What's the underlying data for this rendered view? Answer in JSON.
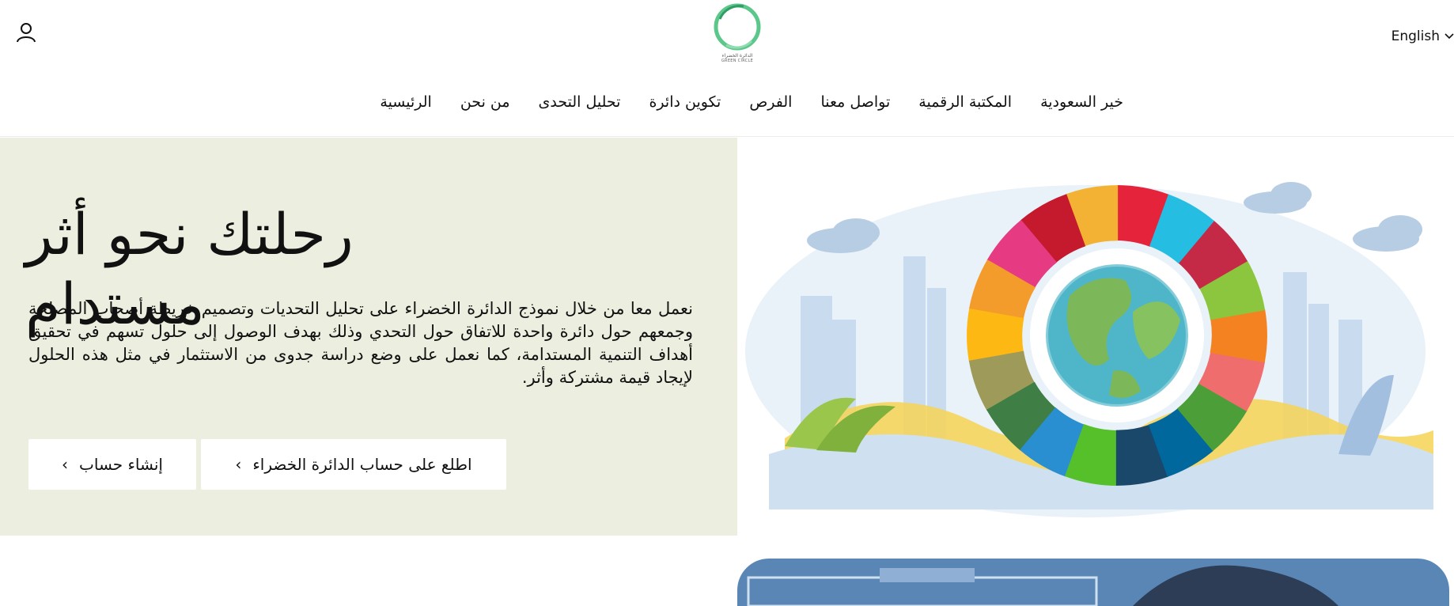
{
  "header": {
    "language_label": "English",
    "logo_ar": "الدائرة الخضراء",
    "logo_en": "GREEN CIRCLE"
  },
  "nav": {
    "items": [
      "الرئيسية",
      "من نحن",
      "تحليل التحدى",
      "تكوين دائرة",
      "الفرص",
      "تواصل معنا",
      "المكتبة الرقمية",
      "خير السعودية"
    ]
  },
  "hero": {
    "title": "رحلتك نحو أثر مستدام",
    "text": "نعمل معا من خلال نموذج الدائرة الخضراء على تحليل التحديات وتصميم خريطة أصحاب المصلحة وجمعهم حول دائرة واحدة للاتفاق حول التحدي وذلك بهدف الوصول إلى حلول تسهم في تحقيق أهداف التنمية المستدامة، كما نعمل على وضع دراسة جدوى من الاستثمار في مثل هذه الحلول لإيجاد قيمة مشتركة وأثر.",
    "btn_create": "إنشاء حساب",
    "btn_view": "اطلع على حساب الدائرة الخضراء"
  },
  "icons": {
    "user": "user-icon",
    "chevron": "chevron-down-icon",
    "arrow": "chevron-left-icon"
  },
  "colors": {
    "hero_bg": "#eceedf",
    "logo_green": "#5cc78a"
  }
}
